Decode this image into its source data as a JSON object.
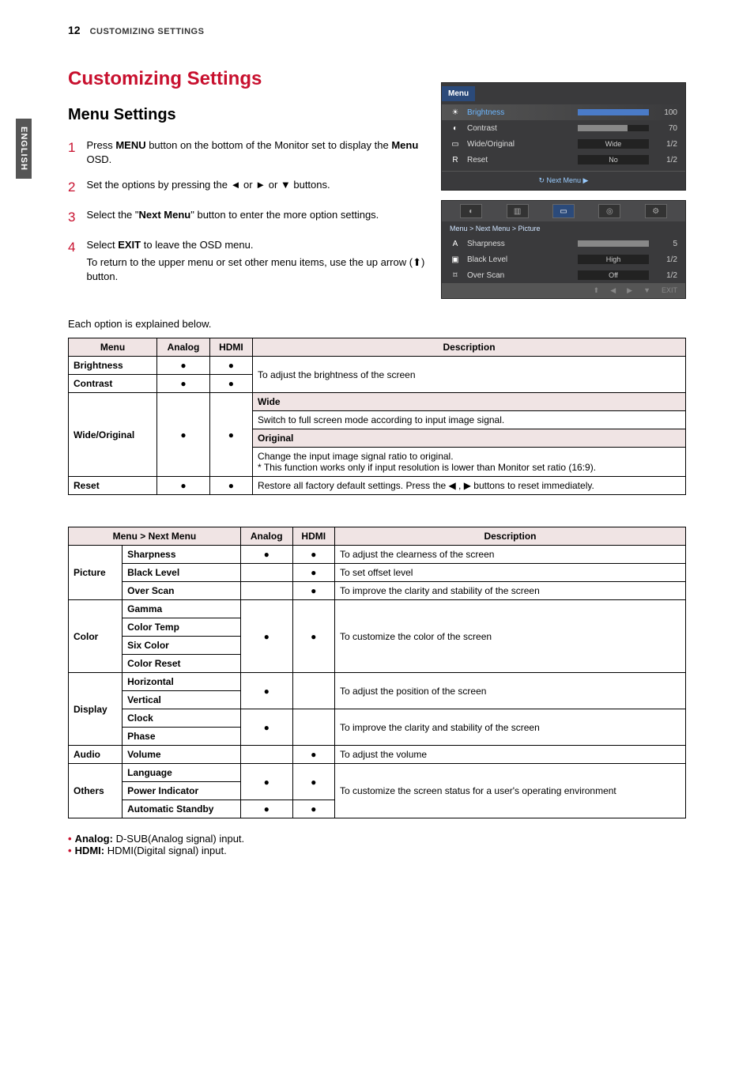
{
  "page": {
    "number": "12",
    "header": "CUSTOMIZING SETTINGS",
    "side_tab": "ENGLISH",
    "h1": "Customizing Settings",
    "h2": "Menu Settings",
    "explain": "Each option is explained below."
  },
  "steps": [
    {
      "num": "1",
      "html": "Press <b>MENU</b> button on the bottom of the Monitor set to display the <b>Menu</b> OSD."
    },
    {
      "num": "2",
      "html": "Set the options by pressing the ◄ or ► or ▼ buttons."
    },
    {
      "num": "3",
      "html": "Select the \"<b>Next Menu</b>\" button to enter the more option settings."
    },
    {
      "num": "4",
      "html": "Select <b>EXIT</b> to leave the OSD menu.<div class=\"sub-line\">To return to the upper menu or set other menu items, use the up arrow (⬆) button.</div>"
    }
  ],
  "osd1": {
    "title": "Menu",
    "rows": [
      {
        "icon": "☀",
        "label": "Brightness",
        "val": "100",
        "bar": 100,
        "hl": true
      },
      {
        "icon": "◐",
        "label": "Contrast",
        "val": "70",
        "bar": 70
      },
      {
        "icon": "▭",
        "label": "Wide/Original",
        "box": "Wide",
        "val": "1/2"
      },
      {
        "icon": "R",
        "label": "Reset",
        "box": "No",
        "val": "1/2"
      }
    ],
    "nav": "↻   Next Menu   ▶"
  },
  "osd2": {
    "tabs": [
      "◐",
      "▥",
      "▭",
      "◎",
      "⚙"
    ],
    "active_tab": 2,
    "breadcrumb": "Menu  >  Next Menu  >  Picture",
    "rows": [
      {
        "icon": "A",
        "label": "Sharpness",
        "bar": 100,
        "val": "5"
      },
      {
        "icon": "▣",
        "label": "Black Level",
        "box": "High",
        "val": "1/2"
      },
      {
        "icon": "⌑",
        "label": "Over Scan",
        "box": "Off",
        "val": "1/2"
      }
    ],
    "bottom_nav": [
      "⬆",
      "◀",
      "▶",
      "▼",
      "EXIT"
    ]
  },
  "table1": {
    "headers": [
      "Menu",
      "Analog",
      "HDMI",
      "Description"
    ],
    "rows": {
      "brightness": {
        "label": "Brightness",
        "analog": "●",
        "hdmi": "●"
      },
      "contrast": {
        "label": "Contrast",
        "analog": "●",
        "hdmi": "●"
      },
      "bc_desc": "To adjust the brightness of the screen",
      "wide_original": {
        "label": "Wide/Original",
        "analog": "●",
        "hdmi": "●"
      },
      "wide_sub": "Wide",
      "wide_desc": "Switch to full screen mode according to input image signal.",
      "orig_sub": "Original",
      "orig_desc": "Change the input image signal ratio to original.\n* This function works only if input resolution is lower than Monitor set ratio (16:9).",
      "reset": {
        "label": "Reset",
        "analog": "●",
        "hdmi": "●",
        "desc": "Restore all factory default settings. Press the ◀ , ▶ buttons to reset immediately."
      }
    }
  },
  "table2": {
    "headers": [
      "Menu > Next Menu",
      "Analog",
      "HDMI",
      "Description"
    ],
    "picture": {
      "label": "Picture",
      "sharpness": {
        "label": "Sharpness",
        "analog": "●",
        "hdmi": "●",
        "desc": "To adjust the clearness of the screen"
      },
      "black": {
        "label": "Black Level",
        "analog": "",
        "hdmi": "●",
        "desc": "To set offset level"
      },
      "over": {
        "label": "Over Scan",
        "analog": "",
        "hdmi": "●",
        "desc": "To improve the clarity and stability of the screen"
      }
    },
    "color": {
      "label": "Color",
      "gamma": "Gamma",
      "temp": "Color Temp",
      "six": "Six Color",
      "reset": "Color Reset",
      "analog": "●",
      "hdmi": "●",
      "desc": "To customize the color of the screen"
    },
    "display": {
      "label": "Display",
      "horizontal": "Horizontal",
      "vertical": "Vertical",
      "clock": "Clock",
      "phase": "Phase",
      "hv_analog": "●",
      "hv_hdmi": "",
      "hv_desc": "To adjust the position of the screen",
      "cp_analog": "●",
      "cp_hdmi": "",
      "cp_desc": "To improve the clarity and stability of the screen"
    },
    "audio": {
      "label": "Audio",
      "volume": {
        "label": "Volume",
        "analog": "",
        "hdmi": "●",
        "desc": "To adjust the volume"
      }
    },
    "others": {
      "label": "Others",
      "language": "Language",
      "power": "Power Indicator",
      "standby": "Automatic Standby",
      "lp_analog": "●",
      "lp_hdmi": "●",
      "desc": "To customize the screen status for a user's operating environment",
      "as_analog": "●",
      "as_hdmi": "●"
    }
  },
  "footnotes": {
    "analog": {
      "label": "Analog:",
      "text": " D-SUB(Analog signal) input."
    },
    "hdmi": {
      "label": "HDMI:",
      "text": " HDMI(Digital signal) input."
    }
  }
}
